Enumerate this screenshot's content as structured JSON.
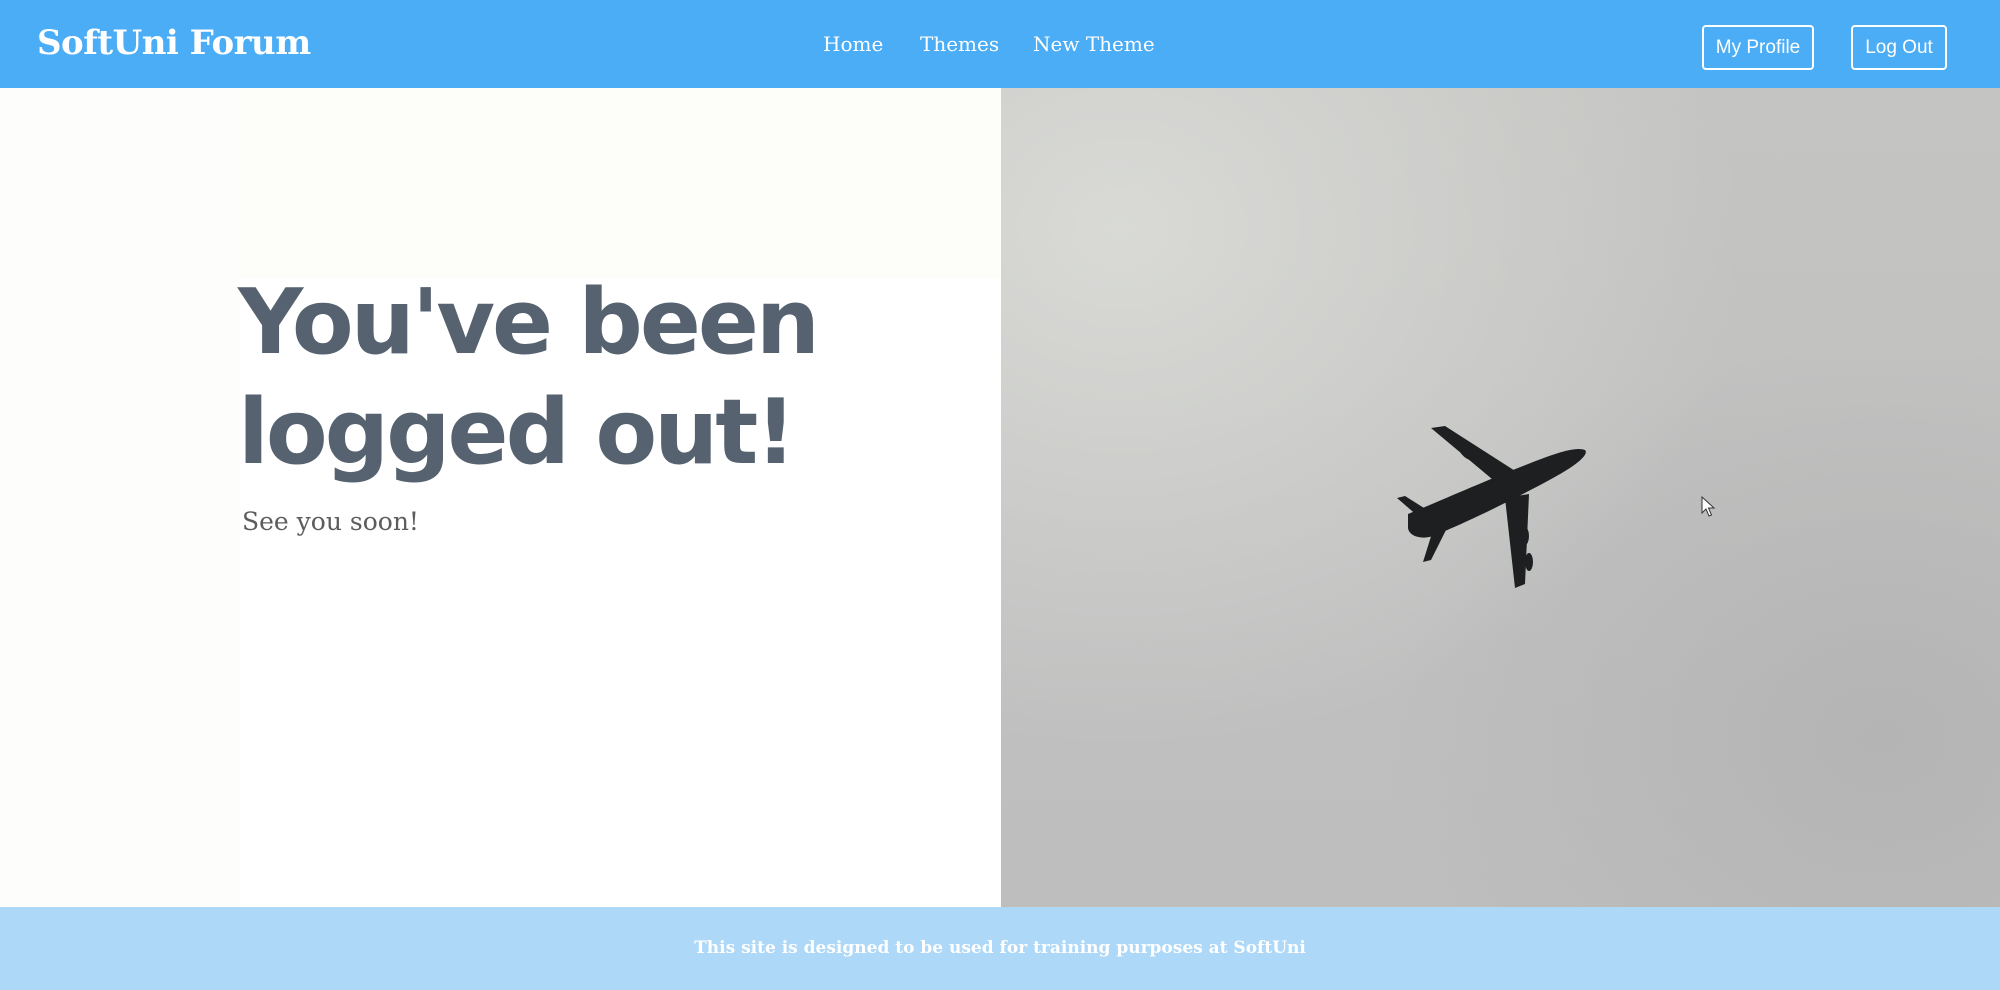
{
  "header": {
    "brand": "SoftUni Forum",
    "nav": [
      {
        "label": "Home"
      },
      {
        "label": "Themes"
      },
      {
        "label": "New Theme"
      }
    ],
    "buttons": {
      "profile": "My Profile",
      "logout": "Log Out"
    }
  },
  "main": {
    "title": "You've been logged out!",
    "subtitle": "See you soon!",
    "image_icon": "airplane-icon"
  },
  "footer": {
    "text": "This site is designed to be used for training purposes at SoftUni"
  },
  "colors": {
    "header_bg": "#4badf5",
    "footer_bg": "#aed8f7",
    "title": "#566270",
    "subtitle": "#5c5c5c"
  }
}
